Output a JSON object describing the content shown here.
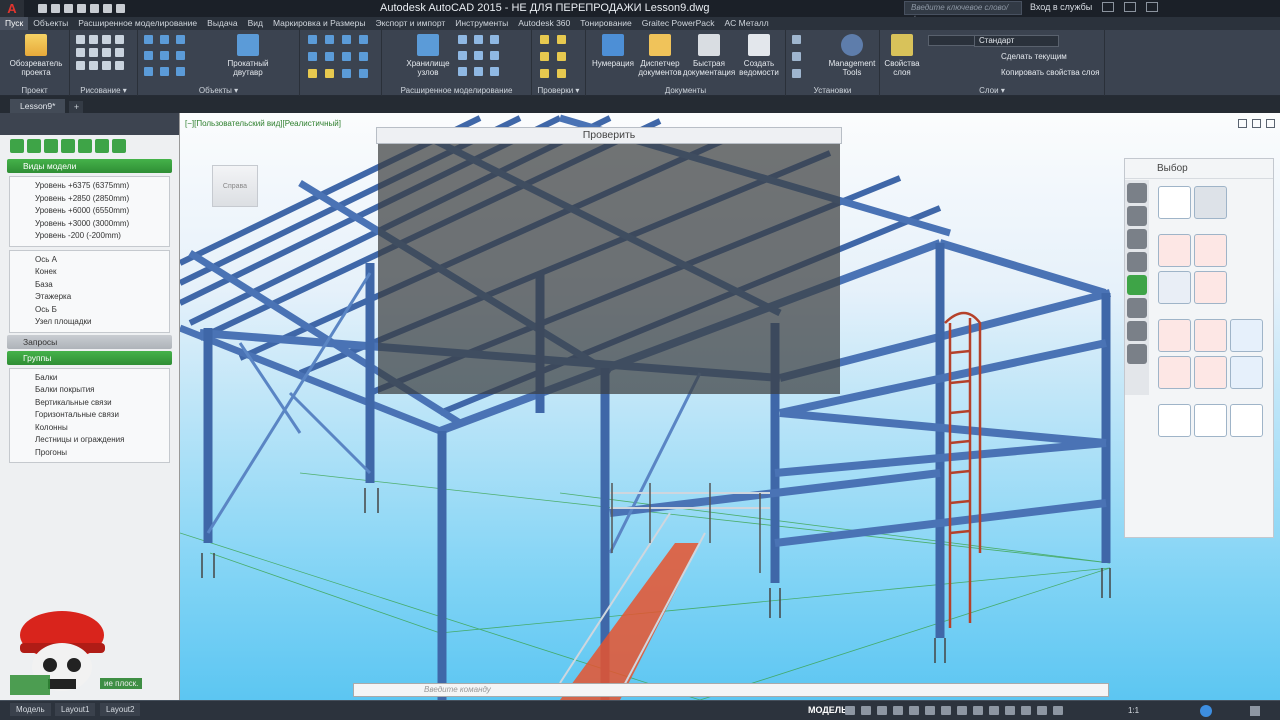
{
  "titlebar": {
    "title": "Autodesk AutoCAD 2015 - НЕ ДЛЯ ПЕРЕПРОДАЖИ    Lesson9.dwg",
    "search_placeholder": "Введите ключевое слово/фразу",
    "signin": "Вход в службы"
  },
  "tabs": [
    "Пуск",
    "Объекты",
    "Расширенное моделирование",
    "Выдача",
    "Вид",
    "Маркировка и Размеры",
    "Экспорт и импорт",
    "Инструменты",
    "Autodesk 360",
    "Тонирование",
    "Graitec PowerPack",
    "AC Металл"
  ],
  "ribbon": {
    "panels": [
      {
        "label": "Проект"
      },
      {
        "label": "Рисование ▾"
      },
      {
        "label": "Объекты ▾"
      },
      {
        "label": "Расширенное моделирование"
      },
      {
        "label": "Проверки ▾"
      },
      {
        "label": "Документы"
      },
      {
        "label": "Установки"
      },
      {
        "label": "Слои ▾"
      }
    ],
    "buttons": {
      "project_explorer": "Обозреватель проекта",
      "rolled_ibeam": "Прокатный двутавр",
      "connection_vault": "Хранилище узлов",
      "numbering": "Нумерация",
      "doc_manager": "Диспетчер документов",
      "quick_doc": "Быстрая документация",
      "create_bom": "Создать ведомости",
      "management_tools": "Management Tools",
      "layer_props": "Свойства слоя"
    },
    "layers": {
      "current": "Стандарт",
      "make_current": "Сделать текущим",
      "copy_props": "Копировать свойства слоя"
    }
  },
  "doctabs": {
    "active": "Lesson9*",
    "add": "+"
  },
  "left_palette": {
    "model_views_header": "Виды модели",
    "levels": [
      "Уровень +6375 (6375mm)",
      "Уровень +2850 (2850mm)",
      "Уровень +6000 (6550mm)",
      "Уровень +3000 (3000mm)",
      "Уровень -200 (-200mm)"
    ],
    "views": [
      "Ось А",
      "Конек",
      "База",
      "Этажерка",
      "Ось Б",
      "Узел площадки"
    ],
    "queries_header": "Запросы",
    "groups_header": "Группы",
    "groups": [
      "Балки",
      "Балки покрытия",
      "Вертикальные связи",
      "Горизонтальные связи",
      "Колонны",
      "Лестницы и ограждения",
      "Прогоны"
    ]
  },
  "viewport": {
    "label": "[−][Пользовательский вид][Реалистичный]",
    "viewcube_label": "Справа",
    "check_title": "Проверить",
    "select_title": "Выбор",
    "cmd_placeholder": "Введите команду",
    "bottom_hint": "ие плоск."
  },
  "statusbar": {
    "tabs": [
      "Модель",
      "Layout1",
      "Layout2"
    ],
    "model_label": "МОДЕЛЬ",
    "scale": "1:1"
  },
  "colors": {
    "beam": "#4a73b5",
    "beam_dark": "#2e4f86",
    "accent_green": "#3ea447",
    "stair_orange": "#e8542e",
    "ladder_red": "#b5412a"
  }
}
